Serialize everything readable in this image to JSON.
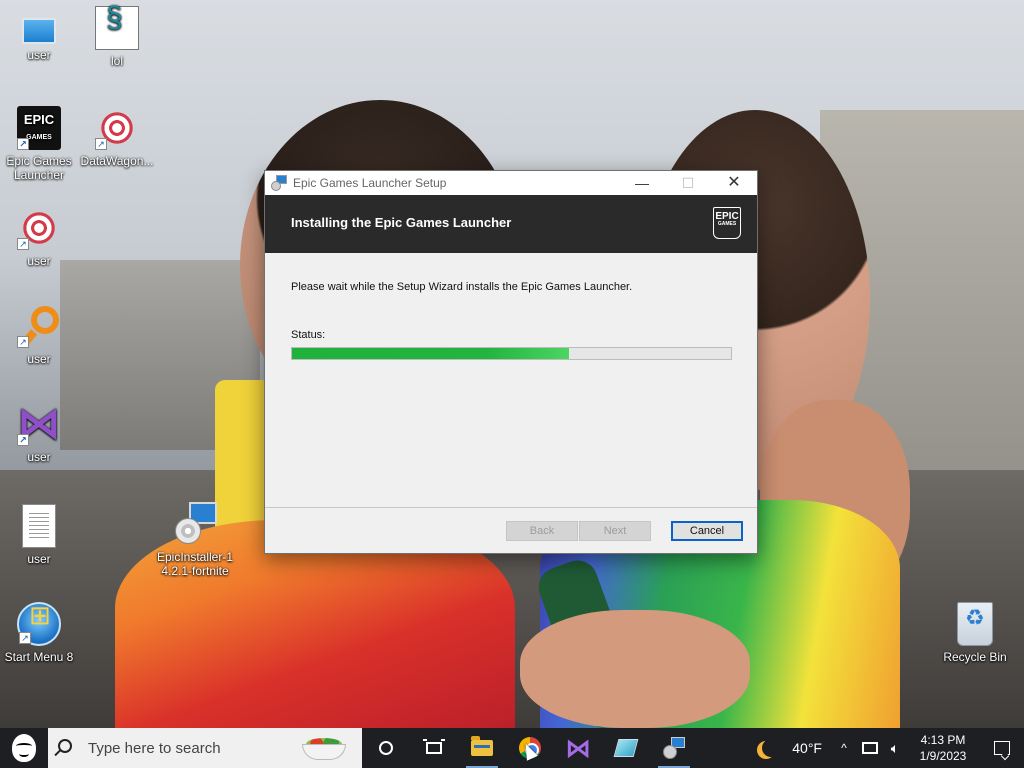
{
  "desktop": {
    "icons": [
      {
        "label": "user",
        "icon": "monitor-icon"
      },
      {
        "label": "lol",
        "icon": "script-icon"
      },
      {
        "label": "Epic Games Launcher",
        "icon": "epic-games-icon"
      },
      {
        "label": "DataWagon...",
        "icon": "datawagon-icon"
      },
      {
        "label": "user",
        "icon": "datawagon-icon"
      },
      {
        "label": "user",
        "icon": "magnifier-icon"
      },
      {
        "label": "user",
        "icon": "visual-studio-icon"
      },
      {
        "label": "user",
        "icon": "text-document-icon"
      },
      {
        "label": "Start Menu 8",
        "icon": "windows7-orb-icon"
      },
      {
        "label": "EpicInstaller-14.2.1-fortnite",
        "icon": "installer-icon"
      },
      {
        "label": "Recycle Bin",
        "icon": "recycle-bin-icon"
      }
    ]
  },
  "dialog": {
    "window_title": "Epic Games Launcher Setup",
    "header_title": "Installing the Epic Games Launcher",
    "logo_text": "EPIC",
    "logo_subtext": "GAMES",
    "message": "Please wait while the Setup Wizard installs the Epic Games Launcher.",
    "status_label": "Status:",
    "progress_percent": 63,
    "buttons": {
      "back": "Back",
      "next": "Next",
      "cancel": "Cancel"
    },
    "minimize_glyph": "—",
    "maximize_glyph": "☐",
    "close_glyph": "✕"
  },
  "taskbar": {
    "search_placeholder": "Type here to search",
    "weather": {
      "temperature": "40°F",
      "icon": "moon-icon"
    },
    "clock": {
      "time": "4:13 PM",
      "date": "1/9/2023"
    },
    "tray_chevron": "^",
    "volume_glyph": "🔈︎",
    "pinned": [
      "cortana-icon",
      "task-view-icon",
      "file-explorer-icon",
      "chrome-icon",
      "visual-studio-icon",
      "pen-icon",
      "installer-icon"
    ]
  },
  "colors": {
    "progress_fill": "#22b43e",
    "dialog_header": "#2a2a2a",
    "taskbar": "#1d1f22",
    "accent": "#0a64c8"
  }
}
